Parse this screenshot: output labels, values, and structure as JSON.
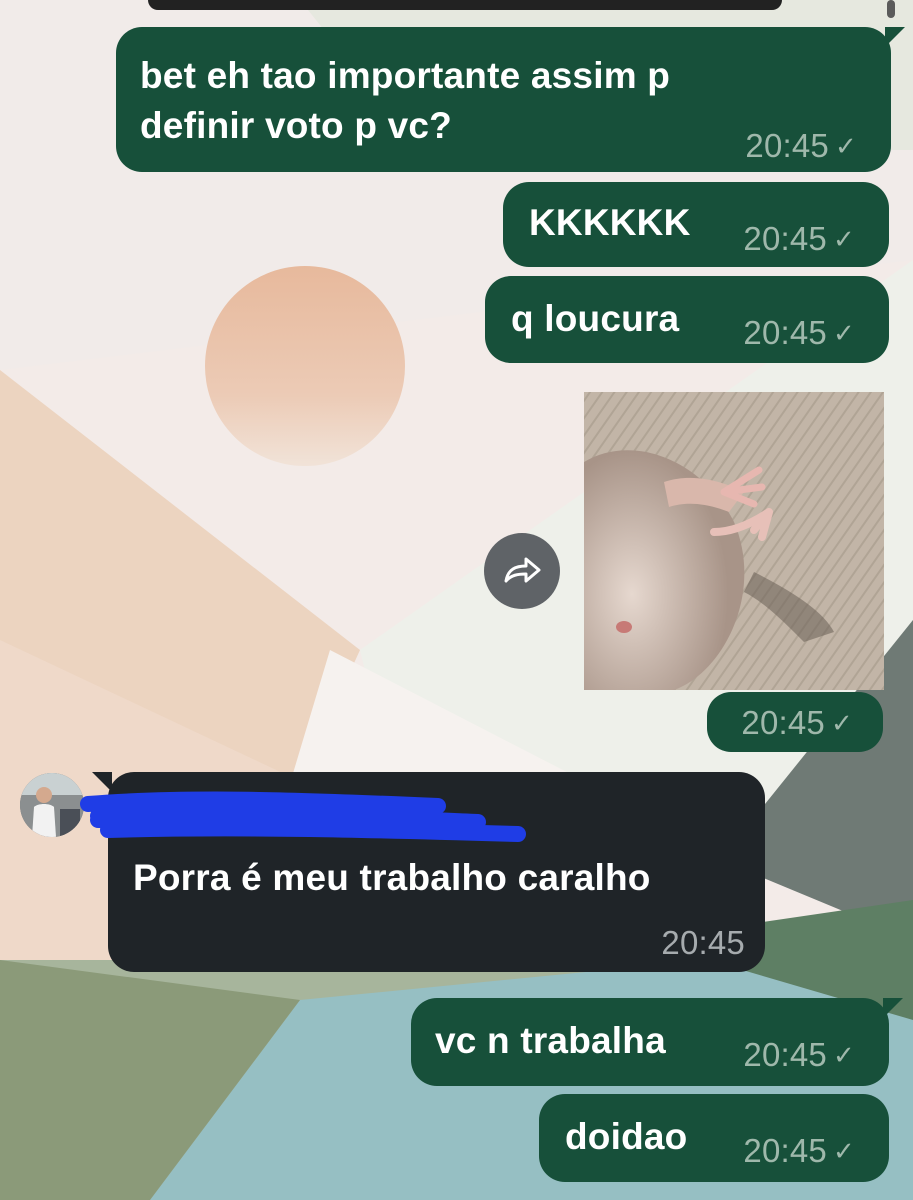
{
  "theme": {
    "outgoing_bubble": "#17503a",
    "incoming_bubble": "#1f2428",
    "redaction_color": "#1f3de6"
  },
  "messages": [
    {
      "text_line1": "bet eh tao importante assim p",
      "text_line2": "definir voto p vc?",
      "time": "20:45",
      "status_icon": "check-icon",
      "status_glyph": "✓"
    },
    {
      "text": "KKKKKK",
      "time": "20:45",
      "status_glyph": "✓"
    },
    {
      "text": "q loucura",
      "time": "20:45",
      "status_glyph": "✓"
    },
    {
      "type": "image",
      "time": "20:45",
      "status_glyph": "✓",
      "forward_icon": "forward-icon"
    },
    {
      "sender": "incoming",
      "avatar_icon": "avatar",
      "text": "Porra é meu trabalho caralho",
      "time": "20:45"
    },
    {
      "text": "vc n trabalha",
      "time": "20:45",
      "status_glyph": "✓"
    },
    {
      "text": "doidao",
      "time": "20:45",
      "status_glyph": "✓"
    }
  ]
}
